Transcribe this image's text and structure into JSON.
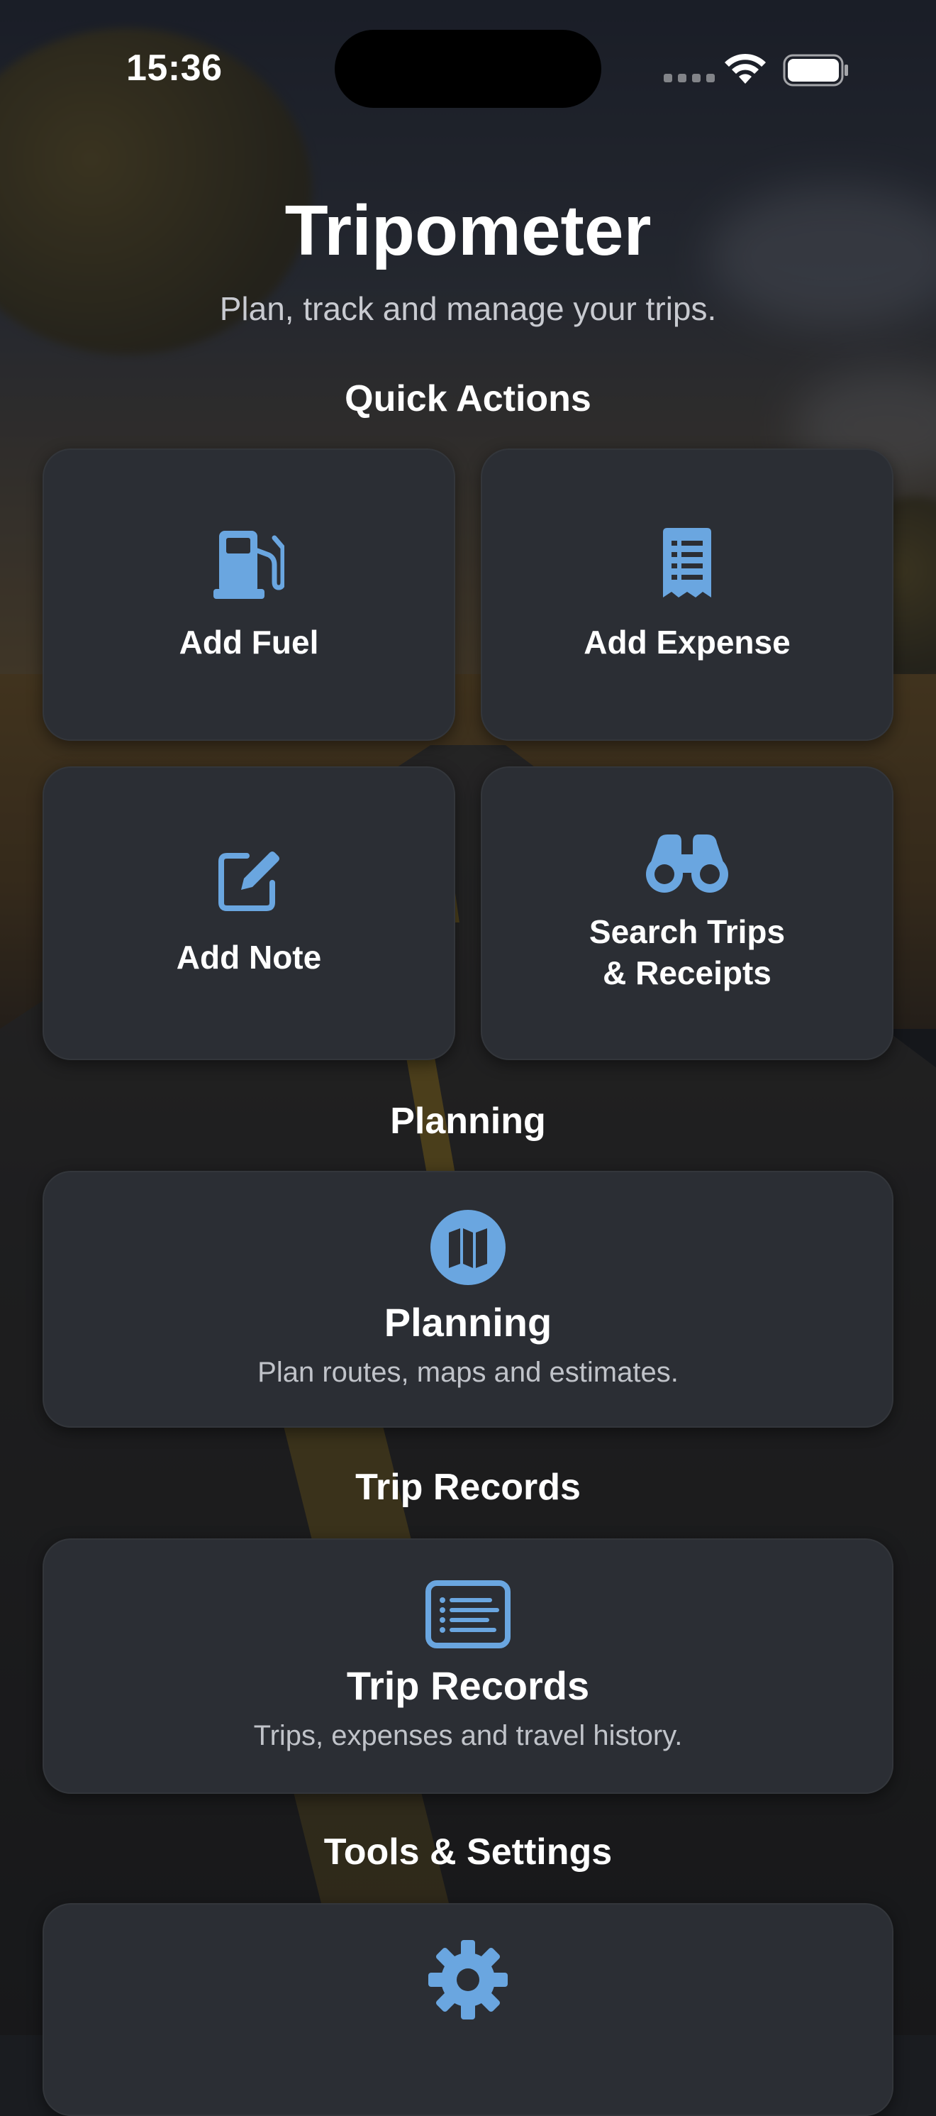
{
  "status_bar": {
    "time": "15:36"
  },
  "header": {
    "title": "Tripometer",
    "subtitle": "Plan, track and manage your trips."
  },
  "sections": {
    "quick_actions": "Quick Actions",
    "planning": "Planning",
    "trip_records": "Trip Records",
    "tools_settings": "Tools & Settings"
  },
  "quick_actions": [
    {
      "label": "Add Fuel",
      "icon": "fuel-pump-icon"
    },
    {
      "label": "Add Expense",
      "icon": "receipt-icon"
    },
    {
      "label": "Add Note",
      "icon": "edit-note-icon"
    },
    {
      "label": "Search Trips\n& Receipts",
      "icon": "binoculars-icon"
    }
  ],
  "planning_card": {
    "title": "Planning",
    "description": "Plan routes, maps and estimates.",
    "icon": "map-icon"
  },
  "trip_records_card": {
    "title": "Trip Records",
    "description": "Trips, expenses and travel history.",
    "icon": "list-icon"
  },
  "tools_card": {
    "icon": "gear-icon"
  },
  "colors": {
    "accent": "#6aa6e0",
    "card_bg": "#2b2e34",
    "text": "#ffffff",
    "muted_text": "#c0c3c9"
  }
}
